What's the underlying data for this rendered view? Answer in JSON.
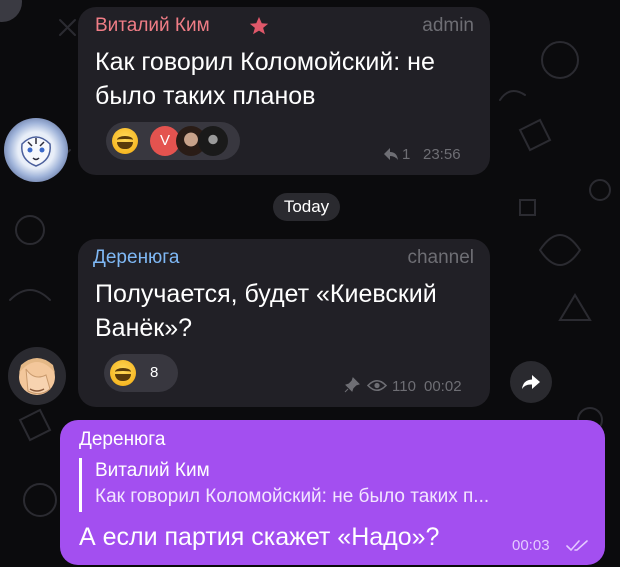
{
  "messages": {
    "m1": {
      "sender": "Виталий Ким",
      "role": "admin",
      "text_line1": "Как говорил Коломойский: не",
      "text_line2": "было таких планов",
      "reply_count": "1",
      "time": "23:56",
      "reactions": [
        {
          "emoji": "grinning-face",
          "avatar_letter": "V"
        }
      ]
    },
    "date_separator": "Today",
    "m2": {
      "sender": "Деренюга",
      "role": "channel",
      "text_line1": "Получается, будет «Киевский",
      "text_line2": "Ванёк»?",
      "reaction_count": "8",
      "views": "110",
      "time": "00:02"
    },
    "m3": {
      "sender": "Деренюга",
      "quote_sender": "Виталий Ким",
      "quote_text": "Как говорил Коломойский: не было таких п...",
      "text": "А если партия скажет «Надо»?",
      "time": "00:03"
    }
  },
  "colors": {
    "background": "#0b0b0d",
    "bubble_incoming": "#212026",
    "bubble_outgoing": "#a34ff0",
    "sender1": "#f07d86",
    "sender2": "#7fb8f5",
    "meta": "#6e6e74"
  },
  "icons": [
    "star-icon",
    "reply-icon",
    "pin-icon",
    "eye-icon",
    "forward-icon",
    "double-check-icon"
  ]
}
